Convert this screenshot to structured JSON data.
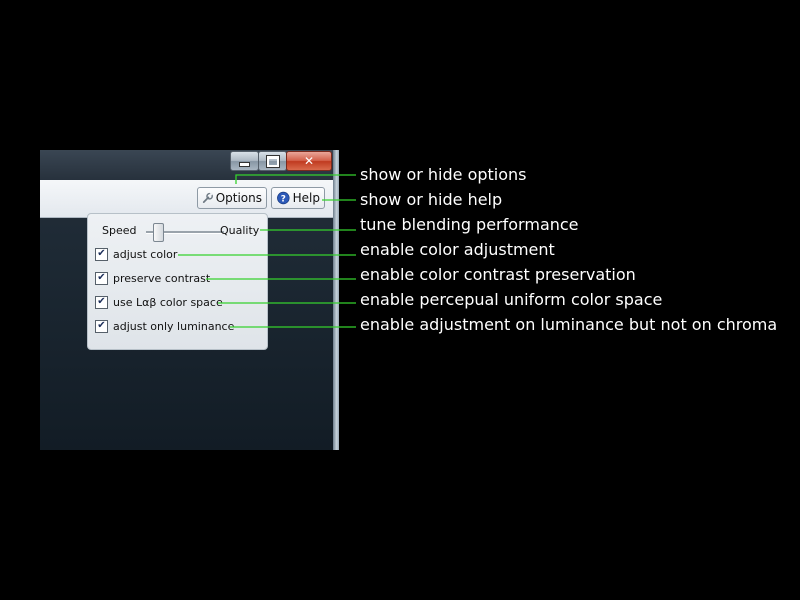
{
  "window": {
    "caption_buttons": [
      {
        "name": "minimize",
        "icon": "minimize-icon"
      },
      {
        "name": "maximize",
        "icon": "maximize-icon"
      },
      {
        "name": "close",
        "icon": "close-icon",
        "glyph": "✕"
      }
    ],
    "toolbar": {
      "options_label": "Options",
      "options_icon": "wrench-icon",
      "help_label": "Help",
      "help_icon": "question-icon"
    }
  },
  "options_panel": {
    "slider": {
      "left_label": "Speed",
      "right_label": "Quality",
      "value": 0.1
    },
    "checkboxes": [
      {
        "label": "adjust color",
        "checked": true
      },
      {
        "label": "preserve contrast",
        "checked": true
      },
      {
        "label": "use Lαβ color space",
        "checked": true
      },
      {
        "label": "adjust only luminance",
        "checked": true
      }
    ]
  },
  "annotations": [
    "show or hide options",
    "show or hide help",
    "tune blending performance",
    "enable color adjustment",
    "enable color contrast preservation",
    "enable percepual uniform color space",
    "enable adjustment on luminance but not on chroma"
  ],
  "colors": {
    "background": "#000000",
    "leader_line": "#35d12c",
    "annotation_text": "#ffffff"
  }
}
